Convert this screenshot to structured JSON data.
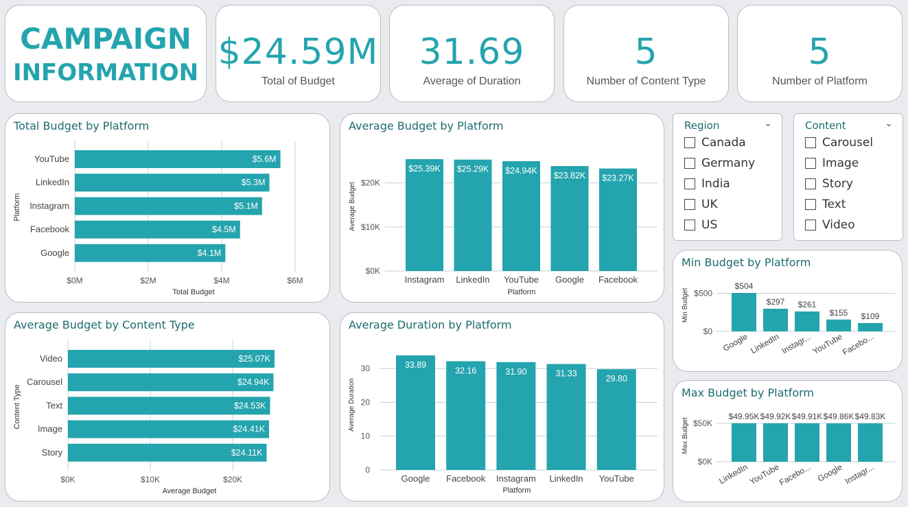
{
  "header": {
    "title_line1": "CAMPAIGN",
    "title_line2": "INFORMATION"
  },
  "kpis": [
    {
      "value": "$24.59M",
      "label": "Total of Budget"
    },
    {
      "value": "31.69",
      "label": "Average of Duration"
    },
    {
      "value": "5",
      "label": "Number of Content Type"
    },
    {
      "value": "5",
      "label": "Number of Platform"
    }
  ],
  "slicers": {
    "region": {
      "title": "Region",
      "items": [
        "Canada",
        "Germany",
        "India",
        "UK",
        "US"
      ]
    },
    "content": {
      "title": "Content",
      "items": [
        "Carousel",
        "Image",
        "Story",
        "Text",
        "Video"
      ]
    }
  },
  "colors": {
    "accent": "#24a4ae",
    "title": "#1d6b6f"
  },
  "icons": {
    "dropdown": "chevron-down-icon"
  },
  "chart_data": [
    {
      "id": "c1",
      "type": "bar",
      "orientation": "horizontal",
      "title": "Total Budget by Platform",
      "categories": [
        "YouTube",
        "LinkedIn",
        "Instagram",
        "Facebook",
        "Google"
      ],
      "values": [
        5.6,
        5.3,
        5.1,
        4.5,
        4.1
      ],
      "labels": [
        "$5.6M",
        "$5.3M",
        "$5.1M",
        "$4.5M",
        "$4.1M"
      ],
      "xlabel": "Total Budget",
      "ylabel": "Platform",
      "xlim": [
        0,
        6
      ],
      "ticks": [
        0,
        2,
        4,
        6
      ],
      "tick_labels": [
        "$0M",
        "$2M",
        "$4M",
        "$6M"
      ],
      "grid": true
    },
    {
      "id": "c2",
      "type": "bar",
      "orientation": "vertical",
      "title": "Average Budget by Platform",
      "categories": [
        "Instagram",
        "LinkedIn",
        "YouTube",
        "Google",
        "Facebook"
      ],
      "values": [
        25.39,
        25.29,
        24.94,
        23.82,
        23.27
      ],
      "labels": [
        "$25.39K",
        "$25.29K",
        "$24.94K",
        "$23.82K",
        "$23.27K"
      ],
      "xlabel": "Platform",
      "ylabel": "Average Budget",
      "ylim": [
        0,
        25.39
      ],
      "ticks": [
        0,
        10,
        20
      ],
      "tick_labels": [
        "$0K",
        "$10K",
        "$20K"
      ],
      "grid": true
    },
    {
      "id": "c3",
      "type": "bar",
      "orientation": "horizontal",
      "title": "Average Budget by Content Type",
      "categories": [
        "Video",
        "Carousel",
        "Text",
        "Image",
        "Story"
      ],
      "values": [
        25.07,
        24.94,
        24.53,
        24.41,
        24.11
      ],
      "labels": [
        "$25.07K",
        "$24.94K",
        "$24.53K",
        "$24.41K",
        "$24.11K"
      ],
      "xlabel": "Average Budget",
      "ylabel": "Content Type",
      "xlim": [
        0,
        25.07
      ],
      "ticks": [
        0,
        10,
        20
      ],
      "tick_labels": [
        "$0K",
        "$10K",
        "$20K"
      ],
      "grid": true
    },
    {
      "id": "c4",
      "type": "bar",
      "orientation": "vertical",
      "title": "Average Duration by Platform",
      "categories": [
        "Google",
        "Facebook",
        "Instagram",
        "LinkedIn",
        "YouTube"
      ],
      "values": [
        33.89,
        32.16,
        31.9,
        31.33,
        29.8
      ],
      "labels": [
        "33.89",
        "32.16",
        "31.90",
        "31.33",
        "29.80"
      ],
      "xlabel": "Platform",
      "ylabel": "Average Duration",
      "ylim": [
        0,
        33.89
      ],
      "ticks": [
        0,
        10,
        20,
        30
      ],
      "tick_labels": [
        "0",
        "10",
        "20",
        "30"
      ],
      "grid": true
    },
    {
      "id": "c5",
      "type": "bar",
      "orientation": "vertical",
      "title": "Min Budget by Platform",
      "categories": [
        "Google",
        "LinkedIn",
        "Instagr...",
        "YouTube",
        "Facebo..."
      ],
      "values": [
        504,
        297,
        261,
        155,
        109
      ],
      "labels": [
        "$504",
        "$297",
        "$261",
        "$155",
        "$109"
      ],
      "ylabel": "Min Budget",
      "ylim": [
        0,
        504
      ],
      "ticks": [
        0,
        500
      ],
      "tick_labels": [
        "$0",
        "$500"
      ],
      "grid": true
    },
    {
      "id": "c6",
      "type": "bar",
      "orientation": "vertical",
      "title": "Max Budget by Platform",
      "categories": [
        "LinkedIn",
        "YouTube",
        "Facebo...",
        "Google",
        "Instagr..."
      ],
      "values": [
        49.95,
        49.92,
        49.91,
        49.86,
        49.83
      ],
      "labels": [
        "$49.95K",
        "$49.92K",
        "$49.91K",
        "$49.86K",
        "$49.83K"
      ],
      "ylabel": "Max Budget",
      "ylim": [
        0,
        49.95
      ],
      "ticks": [
        0,
        50
      ],
      "tick_labels": [
        "$0K",
        "$50K"
      ],
      "grid": true
    }
  ]
}
